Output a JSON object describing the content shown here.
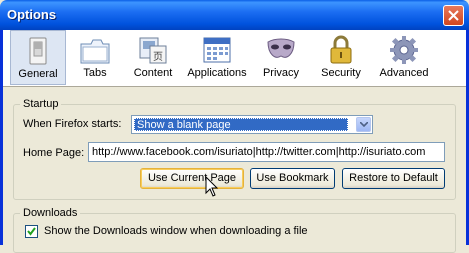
{
  "window": {
    "title": "Options"
  },
  "toolbar": {
    "items": [
      {
        "label": "General",
        "icon": "switch-icon",
        "selected": true
      },
      {
        "label": "Tabs",
        "icon": "tabs-icon"
      },
      {
        "label": "Content",
        "icon": "content-icon"
      },
      {
        "label": "Applications",
        "icon": "applications-icon"
      },
      {
        "label": "Privacy",
        "icon": "mask-icon"
      },
      {
        "label": "Security",
        "icon": "padlock-icon"
      },
      {
        "label": "Advanced",
        "icon": "gear-icon"
      }
    ]
  },
  "startup": {
    "legend": "Startup",
    "when_label": "When Firefox starts:",
    "when_value": "Show a blank page",
    "home_label": "Home Page:",
    "home_value": "http://www.facebook.com/isuriato|http://twitter.com|http://isuriato.com",
    "buttons": {
      "use_current": "Use Current Page",
      "use_bookmark": "Use Bookmark",
      "restore_default": "Restore to Default"
    }
  },
  "downloads": {
    "legend": "Downloads",
    "show_window_label": "Show the Downloads window when downloading a file",
    "show_window_checked": true
  },
  "colors": {
    "titlebar": "#0052dd",
    "selection": "#316ac5",
    "dialog_bg": "#ece9d8"
  }
}
